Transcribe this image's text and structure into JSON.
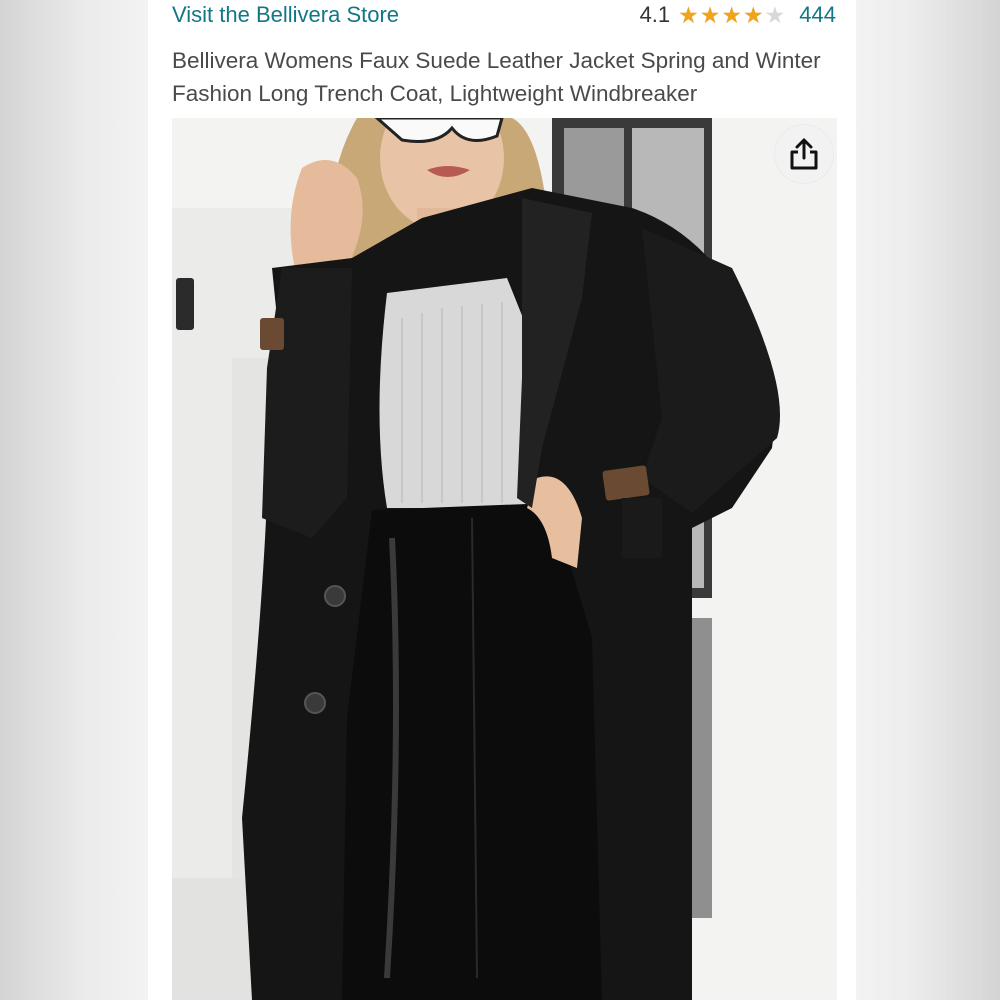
{
  "product": {
    "store_link": "Visit the Bellivera Store",
    "rating": "4.1",
    "rating_fraction": 0.82,
    "review_count": "444",
    "title": "Bellivera Womens Faux Suede Leather Jacket Spring and Winter Fashion Long Trench Coat, Lightweight Windbreaker"
  },
  "image": {
    "description_icon": "product-photo",
    "share_icon": "share-icon"
  },
  "colors": {
    "link": "#117685",
    "star": "#f0a41d",
    "star_empty": "#d8d8d8",
    "coat": "#141414",
    "top": "#d6d6d6"
  }
}
